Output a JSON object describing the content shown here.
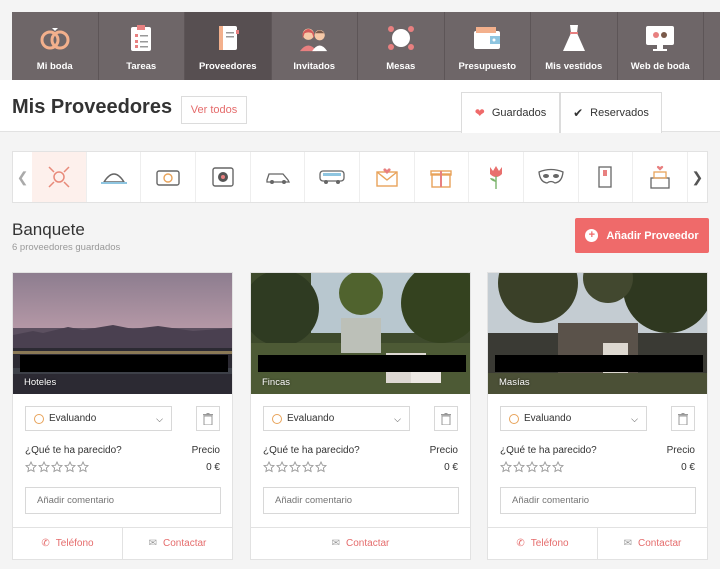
{
  "nav": {
    "items": [
      {
        "label": "Mi boda",
        "icon": "rings-icon"
      },
      {
        "label": "Tareas",
        "icon": "clipboard-icon"
      },
      {
        "label": "Proveedores",
        "icon": "notebook-icon"
      },
      {
        "label": "Invitados",
        "icon": "guests-icon"
      },
      {
        "label": "Mesas",
        "icon": "table-icon"
      },
      {
        "label": "Presupuesto",
        "icon": "wallet-icon"
      },
      {
        "label": "Mis vestidos",
        "icon": "dress-icon"
      },
      {
        "label": "Web de boda",
        "icon": "website-icon"
      }
    ],
    "active_index": 2
  },
  "header": {
    "title": "Mis Proveedores",
    "ver_todos": "Ver todos",
    "tabs": [
      {
        "label": "Guardados",
        "icon": "heart-icon"
      },
      {
        "label": "Reservados",
        "icon": "check-icon"
      }
    ]
  },
  "categories": {
    "icons": [
      "banquet-icon",
      "cloche-icon",
      "camera-icon",
      "video-icon",
      "car-icon",
      "bus-icon",
      "invitation-icon",
      "gift-icon",
      "flower-icon",
      "mask-icon",
      "door-icon",
      "cake-icon"
    ],
    "active_index": 0
  },
  "section": {
    "title": "Banquete",
    "subtitle": "6 proveedores guardados",
    "add_button": "Añadir Proveedor"
  },
  "cards": [
    {
      "category": "Hoteles",
      "status": "Evaluando",
      "question": "¿Qué te ha parecido?",
      "precio_label": "Precio",
      "precio": "0 €",
      "comment_placeholder": "Añadir comentario",
      "telefono": "Teléfono",
      "contactar": "Contactar",
      "rating": 0
    },
    {
      "category": "Fincas",
      "status": "Evaluando",
      "question": "¿Qué te ha parecido?",
      "precio_label": "Precio",
      "precio": "0 €",
      "comment_placeholder": "Añadir comentario",
      "contactar": "Contactar",
      "rating": 0
    },
    {
      "category": "Masías",
      "status": "Evaluando",
      "question": "¿Qué te ha parecido?",
      "precio_label": "Precio",
      "precio": "0 €",
      "comment_placeholder": "Añadir comentario",
      "telefono": "Teléfono",
      "contactar": "Contactar",
      "rating": 0
    }
  ],
  "colors": {
    "accent": "#ef6a6a",
    "nav_bg": "#6e6668",
    "nav_active": "#574f51"
  }
}
